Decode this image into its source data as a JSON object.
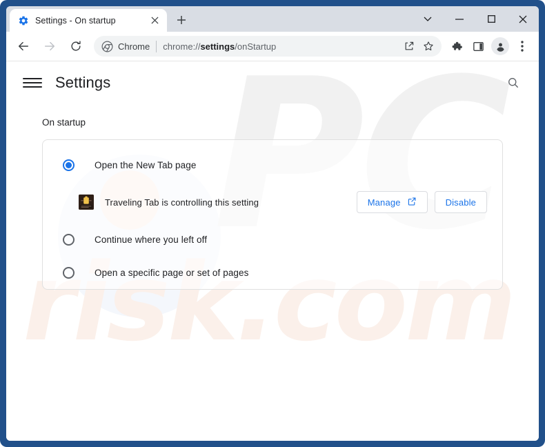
{
  "window": {
    "controls": {
      "tab_search": "tab-search-chevron",
      "minimize": "minimize",
      "maximize": "maximize",
      "close": "close"
    },
    "frame_color": "#21508a",
    "titlebar_color": "#d9dde4"
  },
  "tabstrip": {
    "tabs": [
      {
        "title": "Settings - On startup",
        "favicon": "settings-gear-icon",
        "active": true
      }
    ],
    "new_tab_label": "+",
    "close_label": "✕"
  },
  "toolbar": {
    "back": "back-arrow",
    "forward": "forward-arrow",
    "reload": "reload",
    "omnibox": {
      "chip_icon": "chrome-logo-icon",
      "chip_label": "Chrome",
      "url_prefix": "chrome://",
      "url_bold": "settings",
      "url_suffix": "/onStartup",
      "full_url": "chrome://settings/onStartup",
      "share_icon": "share-icon",
      "bookmark_icon": "star-icon"
    },
    "extensions_icon": "puzzle-piece-icon",
    "side_panel_icon": "side-panel-icon",
    "profile_icon": "profile-avatar-icon",
    "menu_icon": "three-dot-menu-icon"
  },
  "settings": {
    "menu_label": "Main menu",
    "title": "Settings",
    "search_icon": "search-icon",
    "section_label": "On startup",
    "options": [
      {
        "label": "Open the New Tab page",
        "selected": true
      },
      {
        "label": "Continue where you left off",
        "selected": false
      },
      {
        "label": "Open a specific page or set of pages",
        "selected": false
      }
    ],
    "controlled_notice": {
      "icon": "traveling-tab-extension-icon",
      "text": "Traveling Tab is controlling this setting",
      "manage_label": "Manage",
      "manage_icon": "external-link-icon",
      "disable_label": "Disable"
    },
    "accent_color": "#1a73e8"
  },
  "watermark": {
    "part1": "PC",
    "part2": "risk.com"
  }
}
